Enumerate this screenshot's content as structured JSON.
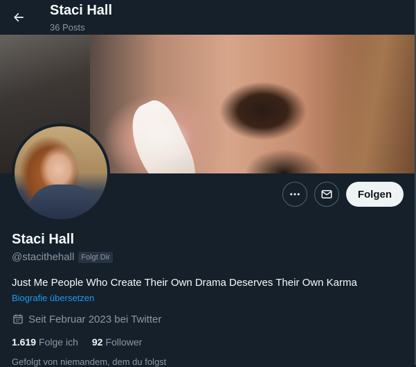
{
  "header": {
    "title": "Staci Hall",
    "post_count": "36 Posts",
    "back_icon": "arrow-left-icon"
  },
  "profile": {
    "display_name": "Staci Hall",
    "handle": "@stacithehall",
    "follows_you_badge": "Folgt Dir",
    "bio": "Just Me People Who Create Their Own Drama Deserves Their Own Karma",
    "translate_link": "Biografie übersetzen",
    "joined": "Seit Februar 2023 bei Twitter",
    "following_count": "1.619",
    "following_label": "Folge ich",
    "followers_count": "92",
    "followers_label": "Follower",
    "followed_by_note": "Gefolgt von niemandem, dem du folgst"
  },
  "actions": {
    "more_icon": "more-horizontal-icon",
    "message_icon": "envelope-icon",
    "follow_label": "Folgen"
  },
  "colors": {
    "background": "#15202b",
    "accent_link": "#1d9bf0",
    "secondary_text": "#8b98a5",
    "primary_text": "#f7f9f9",
    "follow_button": "#eff3f4"
  }
}
